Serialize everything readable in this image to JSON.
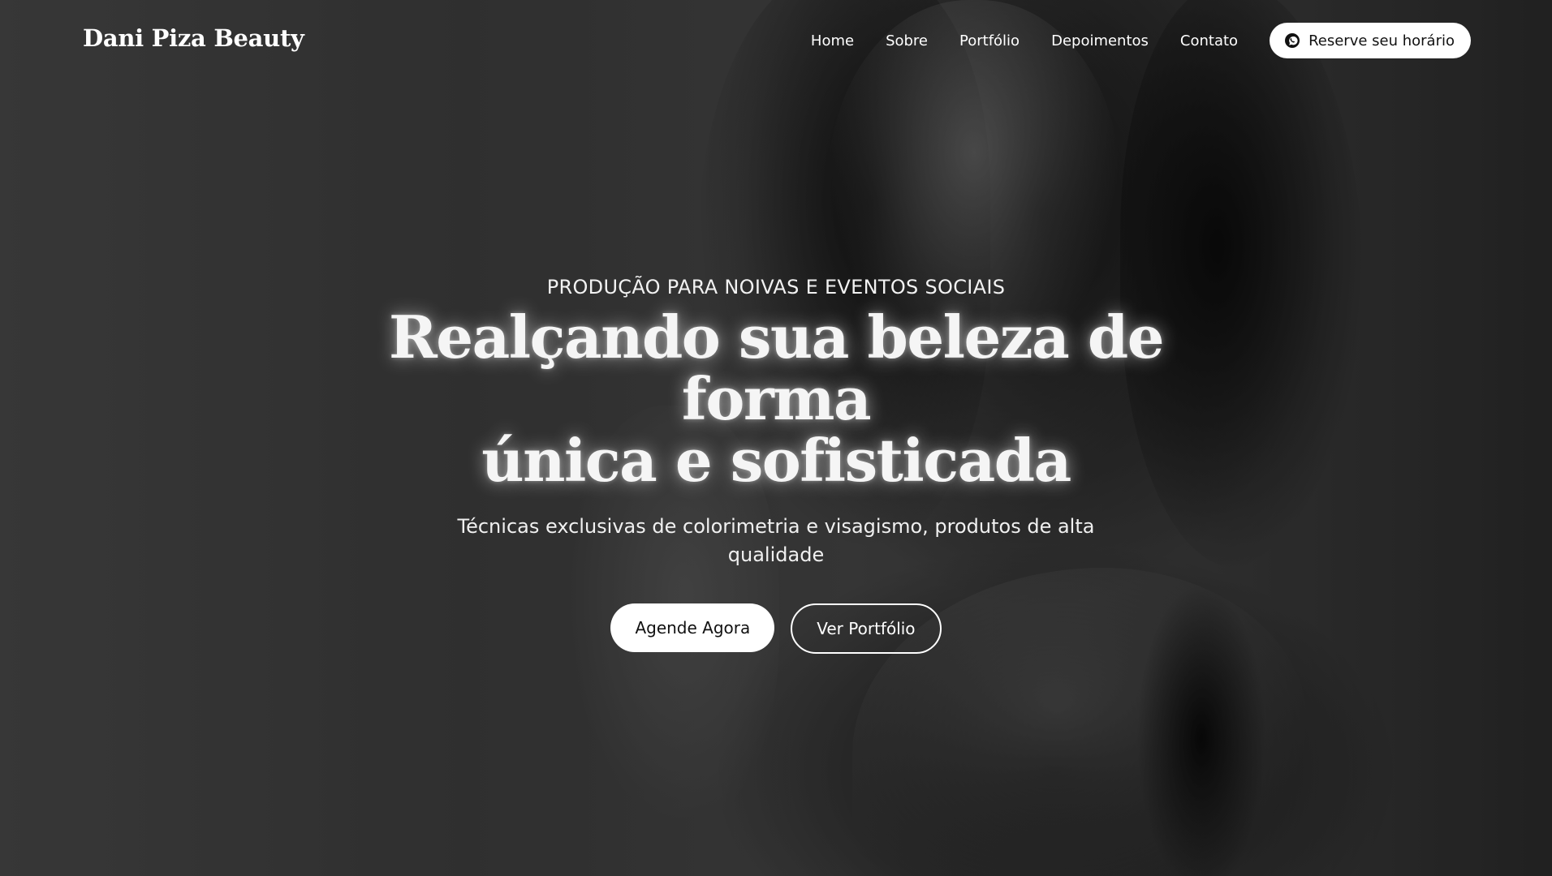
{
  "brand": {
    "name": "Dani Piza Beauty"
  },
  "nav": {
    "items": [
      {
        "label": "Home"
      },
      {
        "label": "Sobre"
      },
      {
        "label": "Portfólio"
      },
      {
        "label": "Depoimentos"
      },
      {
        "label": "Contato"
      }
    ],
    "reserve_button": {
      "label": "Reserve seu horário",
      "icon": "whatsapp-icon"
    }
  },
  "hero": {
    "eyebrow": "PRODUÇÃO PARA NOIVAS E EVENTOS SOCIAIS",
    "headline_line1": "Realçando sua beleza de forma",
    "headline_line2": "única e sofisticada",
    "subtitle": "Técnicas exclusivas de colorimetria e visagismo, produtos de alta qualidade",
    "primary_cta": "Agende Agora",
    "secondary_cta": "Ver Portfólio"
  },
  "colors": {
    "text": "#ffffff",
    "button_bg": "#ffffff",
    "button_text": "#111111"
  }
}
